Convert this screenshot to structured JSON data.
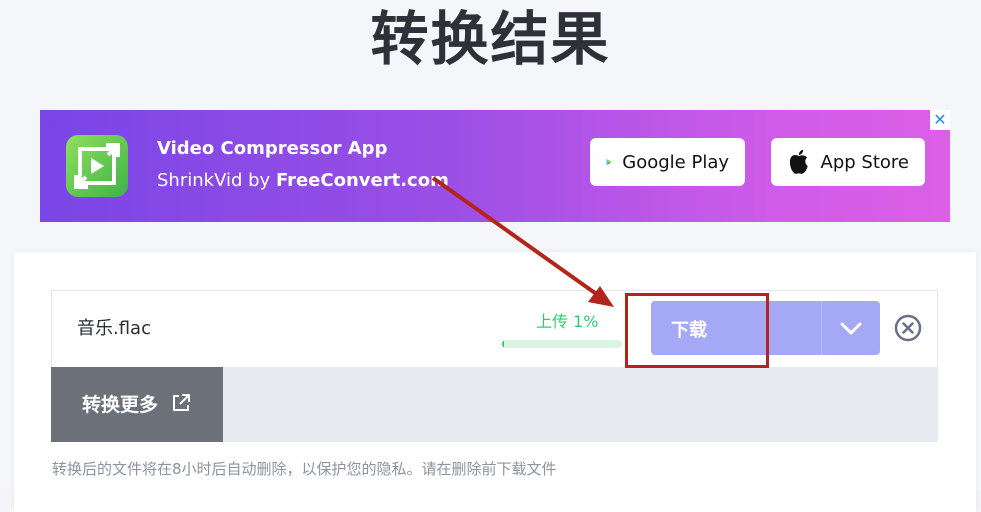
{
  "page": {
    "heading": "转换结果"
  },
  "ad": {
    "close_icon": "close-icon",
    "logo_icon": "video-compress-logo",
    "title": "Video Compressor App",
    "subtitle_prefix": "ShrinkVid by ",
    "subtitle_brand": "FreeConvert.com",
    "google_play_label": "Google Play",
    "app_store_label": "App Store",
    "colors": {
      "gradient_start": "#7a45e6",
      "gradient_end": "#dc5fe8"
    }
  },
  "file": {
    "name": "音乐.flac",
    "status": "上传 1%",
    "progress_percent": 1,
    "download_label": "下载",
    "dropdown_icon": "chevron-down-icon",
    "remove_icon": "close-circle-icon"
  },
  "actions": {
    "convert_more_label": "转换更多",
    "convert_more_icon": "external-link-icon"
  },
  "footer": {
    "note": "转换后的文件将在8小时后自动删除，以保护您的隐私。请在删除前下载文件"
  },
  "annotation": {
    "color": "#b3241a"
  }
}
